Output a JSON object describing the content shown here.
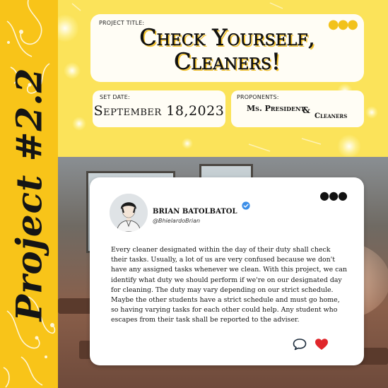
{
  "banner": {
    "vertical_title": "Project #2.2"
  },
  "header": {
    "project_title_label": "PROJECT TITLE:",
    "project_title_line1": "Check Yourself,",
    "project_title_line2": "Cleaners!",
    "set_date_label": "SET DATE:",
    "set_date_value": "September 18,2023",
    "proponents_label": "PROPONENTS:",
    "proponent_1": "Ms. President",
    "proponent_amp": "&",
    "proponent_2": "Cleaners"
  },
  "post": {
    "author_name": "BRIAN BATOLBATOL",
    "author_handle": "@BhielardoBrian",
    "body": "Every cleaner designated within the day of their duty shall check their tasks. Usually, a lot of us are very confused because we don't have any assigned tasks whenever we clean. With this project, we can identify what duty we should perform if we're on our designated day for cleaning. The duty may vary depending on our strict schedule. Maybe the other students have a strict schedule and must go home, so having varying tasks for each other could help. Any student who escapes from their task shall be reported to the adviser.",
    "icons": {
      "verified": "verified-icon",
      "more": "more-options-icon",
      "comment": "comment-icon",
      "like": "heart-icon"
    }
  },
  "colors": {
    "banner_yellow": "#f8c419",
    "band_yellow": "#fbe35a",
    "heart_red": "#e0262b",
    "verified_blue": "#3b8ee8"
  }
}
